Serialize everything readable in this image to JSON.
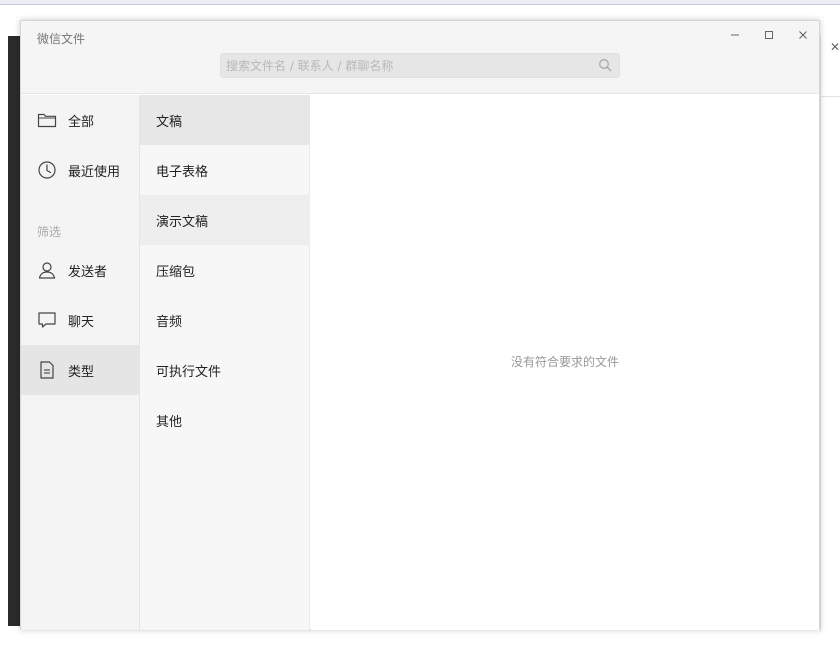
{
  "window": {
    "title": "微信文件",
    "controls": {
      "minimize_icon": "minimize-icon",
      "maximize_icon": "maximize-icon",
      "close_icon": "close-icon"
    }
  },
  "search": {
    "placeholder": "搜索文件名 / 联系人 / 群聊名称",
    "value": "",
    "icon": "search-icon"
  },
  "sidebar": {
    "items": [
      {
        "label": "全部",
        "icon": "folder-icon"
      },
      {
        "label": "最近使用",
        "icon": "clock-icon"
      }
    ],
    "filter_label": "筛选",
    "filter_items": [
      {
        "label": "发送者",
        "icon": "person-icon"
      },
      {
        "label": "聊天",
        "icon": "chat-bubble-icon"
      },
      {
        "label": "类型",
        "icon": "document-icon",
        "active": true
      }
    ]
  },
  "types": {
    "items": [
      {
        "label": "文稿",
        "selected": true
      },
      {
        "label": "电子表格"
      },
      {
        "label": "演示文稿",
        "hover": true
      },
      {
        "label": "压缩包"
      },
      {
        "label": "音频"
      },
      {
        "label": "可执行文件"
      },
      {
        "label": "其他"
      }
    ]
  },
  "content": {
    "empty_message": "没有符合要求的文件"
  },
  "colors": {
    "sidebar_bg": "#f4f4f4",
    "sidebar_active_bg": "#e5e5e5",
    "types_bg": "#f7f7f7",
    "type_selected_bg": "#e7e7e7",
    "titlebar_bg": "#f5f5f5",
    "muted_text": "#999999"
  }
}
